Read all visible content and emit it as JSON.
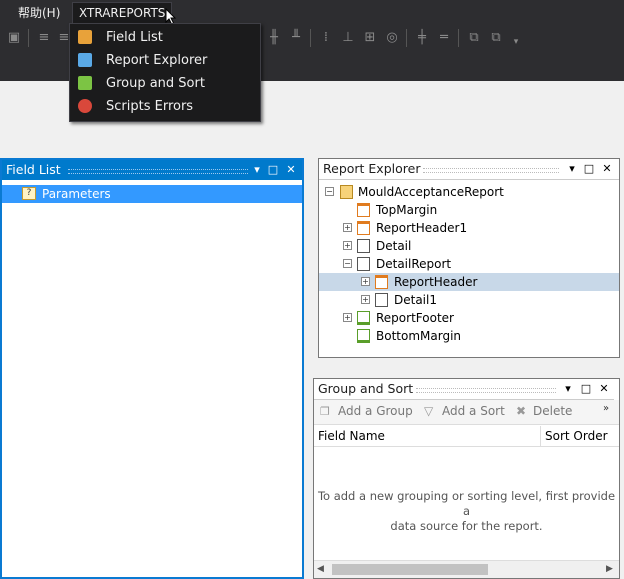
{
  "menubar": {
    "help": "帮助(H)",
    "xtrareports": "XTRAREPORTS"
  },
  "dropdown": {
    "items": [
      {
        "label": "Field List",
        "icon": "field-list-icon"
      },
      {
        "label": "Report Explorer",
        "icon": "report-explorer-icon"
      },
      {
        "label": "Group and Sort",
        "icon": "group-sort-icon"
      },
      {
        "label": "Scripts Errors",
        "icon": "scripts-errors-icon"
      }
    ]
  },
  "field_list": {
    "title": "Field List",
    "items": [
      "Parameters"
    ]
  },
  "report_explorer": {
    "title": "Report Explorer",
    "tree": {
      "root": "MouldAcceptanceReport",
      "top_margin": "TopMargin",
      "report_header1": "ReportHeader1",
      "detail": "Detail",
      "detail_report": "DetailReport",
      "report_header": "ReportHeader",
      "detail1": "Detail1",
      "report_footer": "ReportFooter",
      "bottom_margin": "BottomMargin"
    }
  },
  "group_sort": {
    "title": "Group and Sort",
    "toolbar": {
      "add_group": "Add a Group",
      "add_sort": "Add a Sort",
      "delete": "Delete"
    },
    "columns": {
      "field_name": "Field Name",
      "sort_order": "Sort Order"
    },
    "empty_message_line1": "To add a new grouping or sorting level, first provide a",
    "empty_message_line2": "data source for the report."
  },
  "colors": {
    "accent": "#007acc",
    "selection": "#3399ff",
    "dark_bg": "#2d2d30"
  }
}
